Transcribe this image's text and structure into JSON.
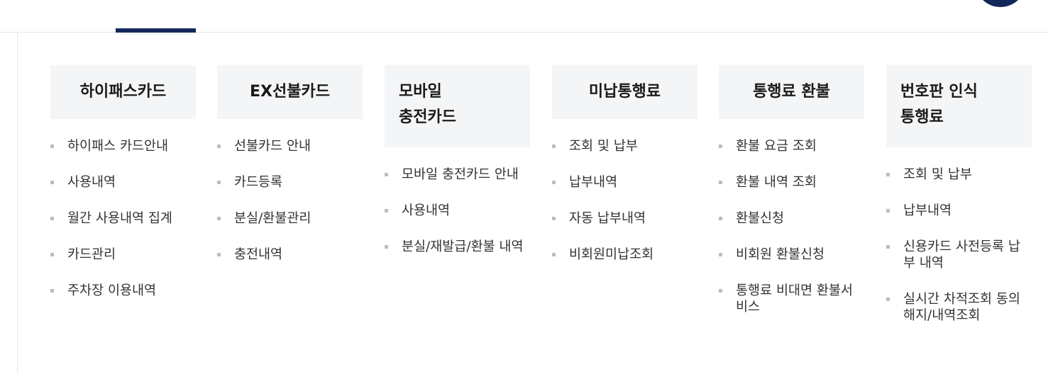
{
  "columns": [
    {
      "title": "하이패스카드",
      "items": [
        "하이패스 카드안내",
        "사용내역",
        "월간 사용내역 집계",
        "카드관리",
        "주차장 이용내역"
      ]
    },
    {
      "title": "EX선불카드",
      "items": [
        "선불카드 안내",
        "카드등록",
        "분실/환불관리",
        "충전내역"
      ]
    },
    {
      "title": "모바일\n충전카드",
      "items": [
        "모바일 충전카드 안내",
        "사용내역",
        "분실/재발급/환불 내역"
      ]
    },
    {
      "title": "미납통행료",
      "items": [
        "조회 및 납부",
        "납부내역",
        "자동 납부내역",
        "비회원미납조회"
      ]
    },
    {
      "title": "통행료 환불",
      "items": [
        "환불 요금 조회",
        "환불 내역 조회",
        "환불신청",
        "비회원 환불신청",
        "통행료 비대면 환불서비스"
      ]
    },
    {
      "title": "번호판 인식\n통행료",
      "items": [
        "조회 및 납부",
        "납부내역",
        "신용카드 사전등록 납부 내역",
        "실시간 차적조회 동의해지/내역조회"
      ]
    }
  ],
  "colors": {
    "accent": "#13285a",
    "header_bg": "#f4f5f7",
    "bullet": "#bdbdbd"
  }
}
